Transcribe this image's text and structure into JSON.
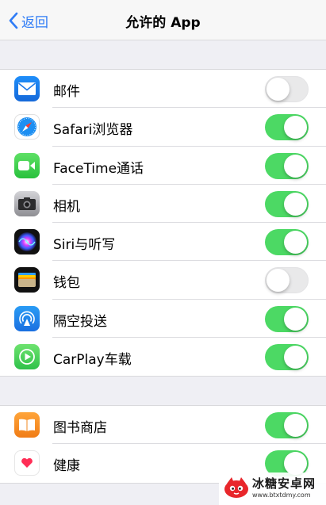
{
  "nav": {
    "back_label": "返回",
    "title": "允许的 App"
  },
  "groups": [
    {
      "rows": [
        {
          "label": "邮件",
          "icon": "mail-icon",
          "on": false
        },
        {
          "label": "Safari浏览器",
          "icon": "safari-icon",
          "on": true
        },
        {
          "label": "FaceTime通话",
          "icon": "facetime-icon",
          "on": true
        },
        {
          "label": "相机",
          "icon": "camera-icon",
          "on": true
        },
        {
          "label": "Siri与听写",
          "icon": "siri-icon",
          "on": true
        },
        {
          "label": "钱包",
          "icon": "wallet-icon",
          "on": false
        },
        {
          "label": "隔空投送",
          "icon": "airdrop-icon",
          "on": true
        },
        {
          "label": "CarPlay车载",
          "icon": "carplay-icon",
          "on": true
        }
      ]
    },
    {
      "rows": [
        {
          "label": "图书商店",
          "icon": "books-icon",
          "on": true
        },
        {
          "label": "健康",
          "icon": "health-icon",
          "on": true
        }
      ]
    }
  ],
  "watermark": {
    "title": "冰糖安卓网",
    "url": "www.btxtdmy.com"
  },
  "colors": {
    "accent": "#2f7cf6",
    "switch_on": "#4cd964",
    "switch_off": "#e9e9ea"
  }
}
